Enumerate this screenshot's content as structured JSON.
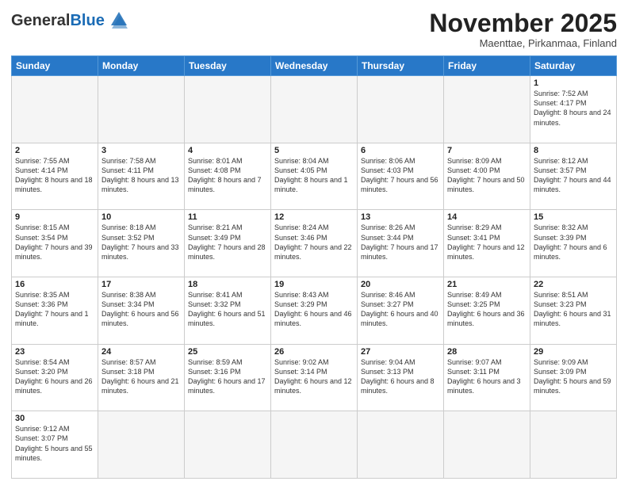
{
  "header": {
    "logo_general": "General",
    "logo_blue": "Blue",
    "month_title": "November 2025",
    "subtitle": "Maenttae, Pirkanmaa, Finland"
  },
  "days_of_week": [
    "Sunday",
    "Monday",
    "Tuesday",
    "Wednesday",
    "Thursday",
    "Friday",
    "Saturday"
  ],
  "weeks": [
    [
      {
        "day": "",
        "info": ""
      },
      {
        "day": "",
        "info": ""
      },
      {
        "day": "",
        "info": ""
      },
      {
        "day": "",
        "info": ""
      },
      {
        "day": "",
        "info": ""
      },
      {
        "day": "",
        "info": ""
      },
      {
        "day": "1",
        "info": "Sunrise: 7:52 AM\nSunset: 4:17 PM\nDaylight: 8 hours\nand 24 minutes."
      }
    ],
    [
      {
        "day": "2",
        "info": "Sunrise: 7:55 AM\nSunset: 4:14 PM\nDaylight: 8 hours\nand 18 minutes."
      },
      {
        "day": "3",
        "info": "Sunrise: 7:58 AM\nSunset: 4:11 PM\nDaylight: 8 hours\nand 13 minutes."
      },
      {
        "day": "4",
        "info": "Sunrise: 8:01 AM\nSunset: 4:08 PM\nDaylight: 8 hours\nand 7 minutes."
      },
      {
        "day": "5",
        "info": "Sunrise: 8:04 AM\nSunset: 4:05 PM\nDaylight: 8 hours\nand 1 minute."
      },
      {
        "day": "6",
        "info": "Sunrise: 8:06 AM\nSunset: 4:03 PM\nDaylight: 7 hours\nand 56 minutes."
      },
      {
        "day": "7",
        "info": "Sunrise: 8:09 AM\nSunset: 4:00 PM\nDaylight: 7 hours\nand 50 minutes."
      },
      {
        "day": "8",
        "info": "Sunrise: 8:12 AM\nSunset: 3:57 PM\nDaylight: 7 hours\nand 44 minutes."
      }
    ],
    [
      {
        "day": "9",
        "info": "Sunrise: 8:15 AM\nSunset: 3:54 PM\nDaylight: 7 hours\nand 39 minutes."
      },
      {
        "day": "10",
        "info": "Sunrise: 8:18 AM\nSunset: 3:52 PM\nDaylight: 7 hours\nand 33 minutes."
      },
      {
        "day": "11",
        "info": "Sunrise: 8:21 AM\nSunset: 3:49 PM\nDaylight: 7 hours\nand 28 minutes."
      },
      {
        "day": "12",
        "info": "Sunrise: 8:24 AM\nSunset: 3:46 PM\nDaylight: 7 hours\nand 22 minutes."
      },
      {
        "day": "13",
        "info": "Sunrise: 8:26 AM\nSunset: 3:44 PM\nDaylight: 7 hours\nand 17 minutes."
      },
      {
        "day": "14",
        "info": "Sunrise: 8:29 AM\nSunset: 3:41 PM\nDaylight: 7 hours\nand 12 minutes."
      },
      {
        "day": "15",
        "info": "Sunrise: 8:32 AM\nSunset: 3:39 PM\nDaylight: 7 hours\nand 6 minutes."
      }
    ],
    [
      {
        "day": "16",
        "info": "Sunrise: 8:35 AM\nSunset: 3:36 PM\nDaylight: 7 hours\nand 1 minute."
      },
      {
        "day": "17",
        "info": "Sunrise: 8:38 AM\nSunset: 3:34 PM\nDaylight: 6 hours\nand 56 minutes."
      },
      {
        "day": "18",
        "info": "Sunrise: 8:41 AM\nSunset: 3:32 PM\nDaylight: 6 hours\nand 51 minutes."
      },
      {
        "day": "19",
        "info": "Sunrise: 8:43 AM\nSunset: 3:29 PM\nDaylight: 6 hours\nand 46 minutes."
      },
      {
        "day": "20",
        "info": "Sunrise: 8:46 AM\nSunset: 3:27 PM\nDaylight: 6 hours\nand 40 minutes."
      },
      {
        "day": "21",
        "info": "Sunrise: 8:49 AM\nSunset: 3:25 PM\nDaylight: 6 hours\nand 36 minutes."
      },
      {
        "day": "22",
        "info": "Sunrise: 8:51 AM\nSunset: 3:23 PM\nDaylight: 6 hours\nand 31 minutes."
      }
    ],
    [
      {
        "day": "23",
        "info": "Sunrise: 8:54 AM\nSunset: 3:20 PM\nDaylight: 6 hours\nand 26 minutes."
      },
      {
        "day": "24",
        "info": "Sunrise: 8:57 AM\nSunset: 3:18 PM\nDaylight: 6 hours\nand 21 minutes."
      },
      {
        "day": "25",
        "info": "Sunrise: 8:59 AM\nSunset: 3:16 PM\nDaylight: 6 hours\nand 17 minutes."
      },
      {
        "day": "26",
        "info": "Sunrise: 9:02 AM\nSunset: 3:14 PM\nDaylight: 6 hours\nand 12 minutes."
      },
      {
        "day": "27",
        "info": "Sunrise: 9:04 AM\nSunset: 3:13 PM\nDaylight: 6 hours\nand 8 minutes."
      },
      {
        "day": "28",
        "info": "Sunrise: 9:07 AM\nSunset: 3:11 PM\nDaylight: 6 hours\nand 3 minutes."
      },
      {
        "day": "29",
        "info": "Sunrise: 9:09 AM\nSunset: 3:09 PM\nDaylight: 5 hours\nand 59 minutes."
      }
    ],
    [
      {
        "day": "30",
        "info": "Sunrise: 9:12 AM\nSunset: 3:07 PM\nDaylight: 5 hours\nand 55 minutes."
      },
      {
        "day": "",
        "info": ""
      },
      {
        "day": "",
        "info": ""
      },
      {
        "day": "",
        "info": ""
      },
      {
        "day": "",
        "info": ""
      },
      {
        "day": "",
        "info": ""
      },
      {
        "day": "",
        "info": ""
      }
    ]
  ]
}
